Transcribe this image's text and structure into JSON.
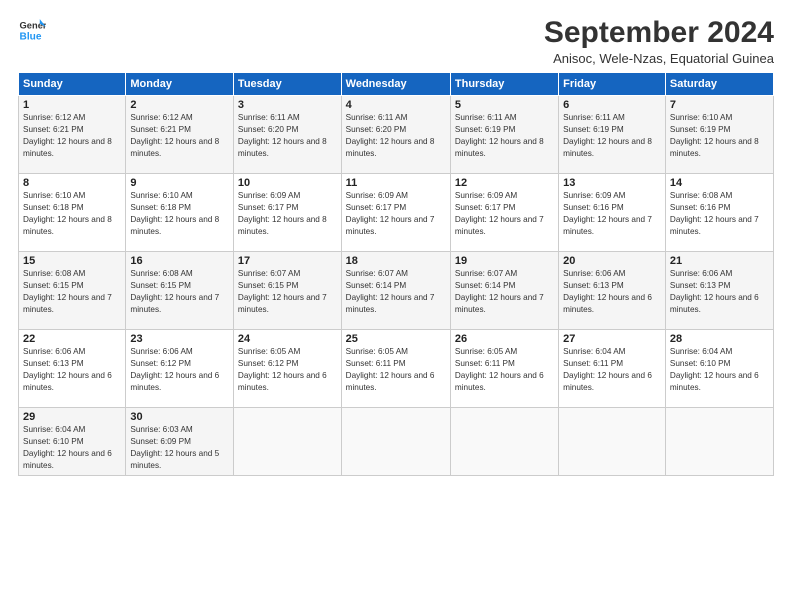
{
  "logo": {
    "line1": "General",
    "line2": "Blue"
  },
  "title": "September 2024",
  "subtitle": "Anisoc, Wele-Nzas, Equatorial Guinea",
  "days_of_week": [
    "Sunday",
    "Monday",
    "Tuesday",
    "Wednesday",
    "Thursday",
    "Friday",
    "Saturday"
  ],
  "weeks": [
    [
      {
        "day": 1,
        "rise": "6:12 AM",
        "set": "6:21 PM",
        "daylight": "12 hours and 8 minutes."
      },
      {
        "day": 2,
        "rise": "6:12 AM",
        "set": "6:21 PM",
        "daylight": "12 hours and 8 minutes."
      },
      {
        "day": 3,
        "rise": "6:11 AM",
        "set": "6:20 PM",
        "daylight": "12 hours and 8 minutes."
      },
      {
        "day": 4,
        "rise": "6:11 AM",
        "set": "6:20 PM",
        "daylight": "12 hours and 8 minutes."
      },
      {
        "day": 5,
        "rise": "6:11 AM",
        "set": "6:19 PM",
        "daylight": "12 hours and 8 minutes."
      },
      {
        "day": 6,
        "rise": "6:11 AM",
        "set": "6:19 PM",
        "daylight": "12 hours and 8 minutes."
      },
      {
        "day": 7,
        "rise": "6:10 AM",
        "set": "6:19 PM",
        "daylight": "12 hours and 8 minutes."
      }
    ],
    [
      {
        "day": 8,
        "rise": "6:10 AM",
        "set": "6:18 PM",
        "daylight": "12 hours and 8 minutes."
      },
      {
        "day": 9,
        "rise": "6:10 AM",
        "set": "6:18 PM",
        "daylight": "12 hours and 8 minutes."
      },
      {
        "day": 10,
        "rise": "6:09 AM",
        "set": "6:17 PM",
        "daylight": "12 hours and 8 minutes."
      },
      {
        "day": 11,
        "rise": "6:09 AM",
        "set": "6:17 PM",
        "daylight": "12 hours and 7 minutes."
      },
      {
        "day": 12,
        "rise": "6:09 AM",
        "set": "6:17 PM",
        "daylight": "12 hours and 7 minutes."
      },
      {
        "day": 13,
        "rise": "6:09 AM",
        "set": "6:16 PM",
        "daylight": "12 hours and 7 minutes."
      },
      {
        "day": 14,
        "rise": "6:08 AM",
        "set": "6:16 PM",
        "daylight": "12 hours and 7 minutes."
      }
    ],
    [
      {
        "day": 15,
        "rise": "6:08 AM",
        "set": "6:15 PM",
        "daylight": "12 hours and 7 minutes."
      },
      {
        "day": 16,
        "rise": "6:08 AM",
        "set": "6:15 PM",
        "daylight": "12 hours and 7 minutes."
      },
      {
        "day": 17,
        "rise": "6:07 AM",
        "set": "6:15 PM",
        "daylight": "12 hours and 7 minutes."
      },
      {
        "day": 18,
        "rise": "6:07 AM",
        "set": "6:14 PM",
        "daylight": "12 hours and 7 minutes."
      },
      {
        "day": 19,
        "rise": "6:07 AM",
        "set": "6:14 PM",
        "daylight": "12 hours and 7 minutes."
      },
      {
        "day": 20,
        "rise": "6:06 AM",
        "set": "6:13 PM",
        "daylight": "12 hours and 6 minutes."
      },
      {
        "day": 21,
        "rise": "6:06 AM",
        "set": "6:13 PM",
        "daylight": "12 hours and 6 minutes."
      }
    ],
    [
      {
        "day": 22,
        "rise": "6:06 AM",
        "set": "6:13 PM",
        "daylight": "12 hours and 6 minutes."
      },
      {
        "day": 23,
        "rise": "6:06 AM",
        "set": "6:12 PM",
        "daylight": "12 hours and 6 minutes."
      },
      {
        "day": 24,
        "rise": "6:05 AM",
        "set": "6:12 PM",
        "daylight": "12 hours and 6 minutes."
      },
      {
        "day": 25,
        "rise": "6:05 AM",
        "set": "6:11 PM",
        "daylight": "12 hours and 6 minutes."
      },
      {
        "day": 26,
        "rise": "6:05 AM",
        "set": "6:11 PM",
        "daylight": "12 hours and 6 minutes."
      },
      {
        "day": 27,
        "rise": "6:04 AM",
        "set": "6:11 PM",
        "daylight": "12 hours and 6 minutes."
      },
      {
        "day": 28,
        "rise": "6:04 AM",
        "set": "6:10 PM",
        "daylight": "12 hours and 6 minutes."
      }
    ],
    [
      {
        "day": 29,
        "rise": "6:04 AM",
        "set": "6:10 PM",
        "daylight": "12 hours and 6 minutes."
      },
      {
        "day": 30,
        "rise": "6:03 AM",
        "set": "6:09 PM",
        "daylight": "12 hours and 5 minutes."
      },
      null,
      null,
      null,
      null,
      null
    ]
  ]
}
